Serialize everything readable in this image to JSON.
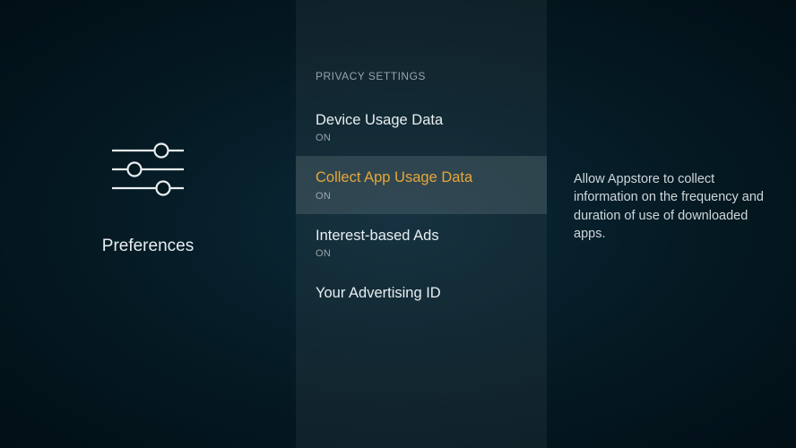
{
  "left": {
    "title": "Preferences"
  },
  "section_header": "PRIVACY SETTINGS",
  "settings": [
    {
      "label": "Device Usage Data",
      "status": "ON"
    },
    {
      "label": "Collect App Usage Data",
      "status": "ON"
    },
    {
      "label": "Interest-based Ads",
      "status": "ON"
    },
    {
      "label": "Your Advertising ID",
      "status": ""
    }
  ],
  "selected_index": 1,
  "description": "Allow Appstore to collect information on the frequency and duration of use of downloaded apps."
}
